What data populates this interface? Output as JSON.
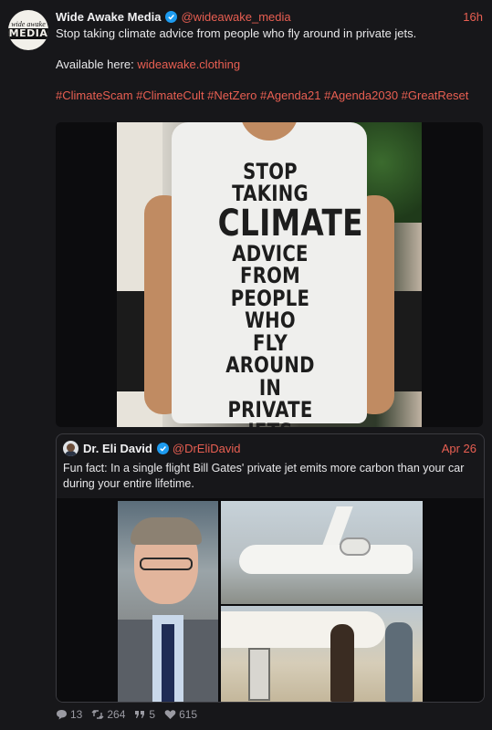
{
  "post": {
    "author_name": "Wide Awake Media",
    "author_handle": "@wideawake_media",
    "time": "16h",
    "avatar_line1": "wide awake",
    "avatar_line2": "MEDIA",
    "text_line1": "Stop taking climate advice from people who fly around in private jets.",
    "available_label": "Available here: ",
    "available_link": "wideawake.clothing",
    "hashtags": "#ClimateScam #ClimateCult #NetZero #Agenda21 #Agenda2030 #GreatReset",
    "shirt_print": [
      "STOP TAKING",
      "CLIMATE",
      "ADVICE FROM",
      "PEOPLE WHO",
      "FLY AROUND IN",
      "PRIVATE JETS"
    ]
  },
  "quote": {
    "author_name": "Dr. Eli David",
    "author_handle": "@DrEliDavid",
    "time": "Apr 26",
    "text": "Fun fact: In a single flight Bill Gates' private jet emits more carbon than your car during your entire lifetime."
  },
  "stats": {
    "replies": "13",
    "boosts": "264",
    "quotes": "5",
    "likes": "615"
  },
  "colors": {
    "accent": "#e95f52",
    "verified": "#1d9bf0",
    "background": "#17171a"
  }
}
